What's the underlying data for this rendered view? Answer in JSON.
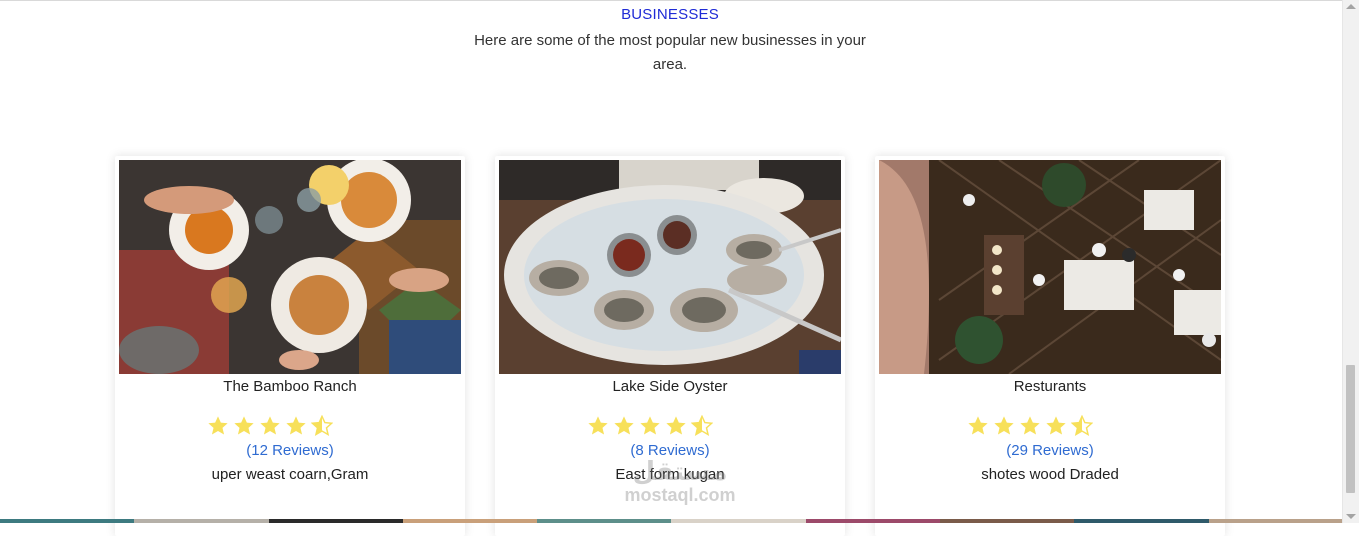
{
  "header": {
    "eyebrow": "BUSINESSES",
    "subtitle": "Here are some of the most popular new businesses in your area."
  },
  "cards": [
    {
      "name": "The Bamboo Ranch",
      "rating": 4.5,
      "reviews": "(12 Reviews)",
      "address": "uper weast coarn,Gram",
      "image": "friends-sharing-fries-and-burgers-photo"
    },
    {
      "name": "Lake Side Oyster",
      "rating": 4.5,
      "reviews": "(8 Reviews)",
      "address": "East form kugan",
      "image": "oysters-on-ice-platter-photo"
    },
    {
      "name": "Resturants",
      "rating": 4.5,
      "reviews": "(29 Reviews)",
      "address": "shotes wood Draded",
      "image": "restaurant-dining-room-overhead-photo"
    }
  ],
  "watermark": {
    "line1": "مستقل",
    "line2": "mostaql.com"
  },
  "colors": {
    "accent": "#1f2bd6",
    "link": "#2f6bd1",
    "star": "#f7e05a"
  }
}
